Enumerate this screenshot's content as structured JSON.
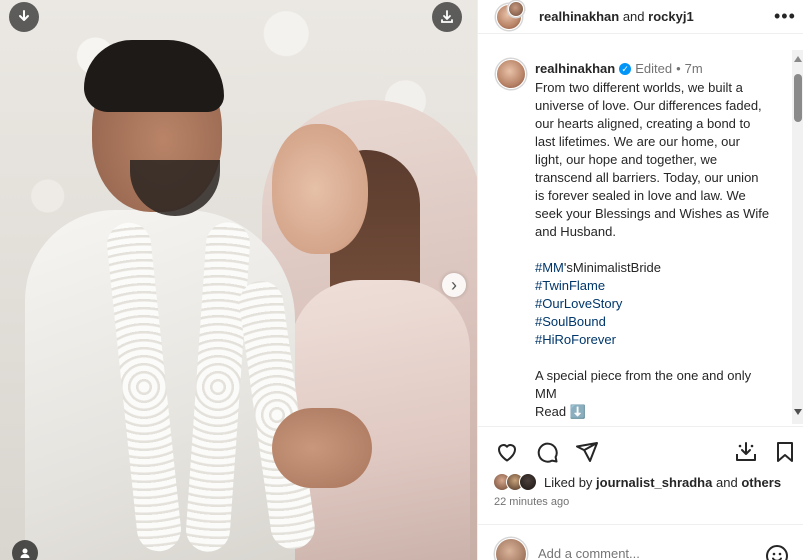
{
  "post": {
    "image_alt_semantic": "photo",
    "carousel_next": "›"
  },
  "header": {
    "author": "realhinakhan",
    "joiner": "and",
    "coauthor": "rockyj1",
    "more": "•••"
  },
  "caption": {
    "username": "realhinakhan",
    "verified_mark": "✓",
    "edited": "Edited",
    "dot": "•",
    "time": "7m",
    "text": "From two different worlds, we built a universe of love. Our differences faded, our hearts aligned, creating a bond to last lifetimes. We are our home, our light, our hope and together, we transcend all barriers. Today, our union is forever sealed in love and law. We seek your Blessings and Wishes as Wife and Husband.",
    "hashtags": [
      {
        "tag": "#MM",
        "suffix": "'sMinimalistBride"
      },
      {
        "tag": "#TwinFlame",
        "suffix": ""
      },
      {
        "tag": "#OurLoveStory",
        "suffix": ""
      },
      {
        "tag": "#SoulBound",
        "suffix": ""
      },
      {
        "tag": "#HiRoForever",
        "suffix": ""
      }
    ],
    "closing": "A special piece from the one and only MM",
    "read": "Read",
    "read_emoji": "⬇️"
  },
  "likes": {
    "prefix": "Liked by",
    "user": "journalist_shradha",
    "joiner": "and",
    "others": "others"
  },
  "time_ago": "22 minutes ago",
  "comment": {
    "placeholder": "Add a comment..."
  }
}
